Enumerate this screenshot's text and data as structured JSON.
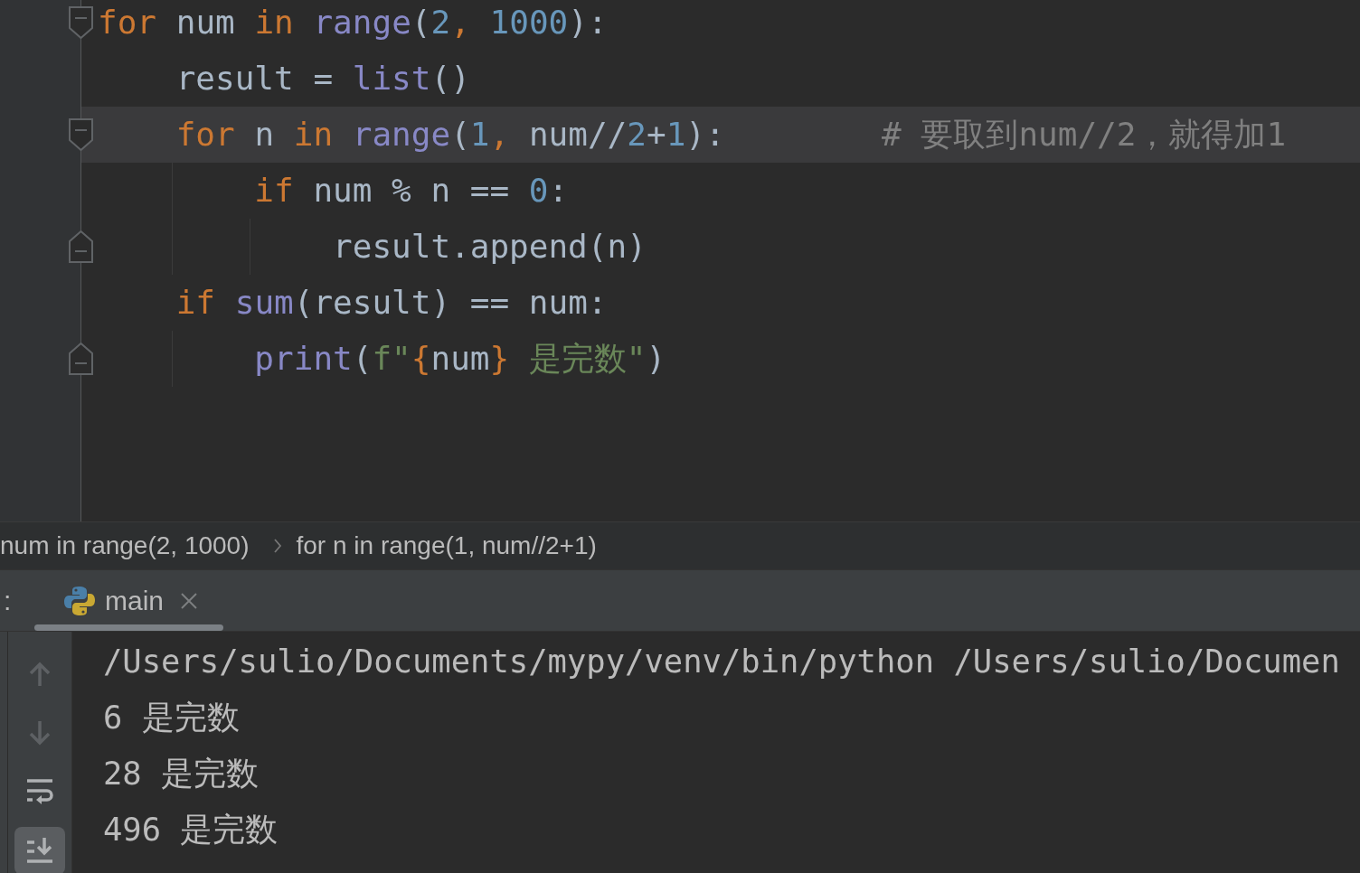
{
  "editor": {
    "lines": [
      {
        "expanded": true,
        "tokens": [
          {
            "kind": "keyword",
            "t": "for"
          },
          {
            "kind": "plain",
            "t": " num "
          },
          {
            "kind": "keyword",
            "t": "in"
          },
          {
            "kind": "builtin",
            "t": " range"
          },
          {
            "kind": "plain",
            "t": "("
          },
          {
            "kind": "number",
            "t": "2"
          },
          {
            "kind": "keyword",
            "t": ", "
          },
          {
            "kind": "number",
            "t": "1000"
          },
          {
            "kind": "plain",
            "t": "):"
          }
        ],
        "children": [
          {
            "tokens": [
              {
                "kind": "plain",
                "t": "result = "
              },
              {
                "kind": "builtin",
                "t": "list"
              },
              {
                "kind": "plain",
                "t": "()"
              }
            ]
          },
          {
            "expanded": true,
            "current": true,
            "tokens": [
              {
                "kind": "keyword",
                "t": "for"
              },
              {
                "kind": "plain",
                "t": " n "
              },
              {
                "kind": "keyword",
                "t": "in"
              },
              {
                "kind": "builtin",
                "t": " range"
              },
              {
                "kind": "plain",
                "t": "("
              },
              {
                "kind": "number",
                "t": "1"
              },
              {
                "kind": "keyword",
                "t": ", "
              },
              {
                "kind": "plain",
                "t": "num//"
              },
              {
                "kind": "number",
                "t": "2"
              },
              {
                "kind": "plain",
                "t": "+"
              },
              {
                "kind": "number",
                "t": "1"
              },
              {
                "kind": "plain",
                "t": "):"
              },
              {
                "kind": "comment",
                "t": "        # 要取到num//2，就得加1"
              }
            ],
            "children": [
              {
                "tokens": [
                  {
                    "kind": "keyword",
                    "t": "if"
                  },
                  {
                    "kind": "plain",
                    "t": " num % n == "
                  },
                  {
                    "kind": "number",
                    "t": "0"
                  },
                  {
                    "kind": "plain",
                    "t": ":"
                  }
                ],
                "children": [
                  {
                    "tokens": [
                      {
                        "kind": "plain",
                        "t": "result.append(n)"
                      }
                    ]
                  }
                ]
              }
            ]
          },
          {
            "tokens": [
              {
                "kind": "keyword",
                "t": "if"
              },
              {
                "kind": "builtin",
                "t": " sum"
              },
              {
                "kind": "plain",
                "t": "(result) == num:"
              }
            ],
            "children": [
              {
                "tokens": [
                  {
                    "kind": "builtin",
                    "t": "print"
                  },
                  {
                    "kind": "plain",
                    "t": "("
                  },
                  {
                    "kind": "string",
                    "t": "f\""
                  },
                  {
                    "kind": "keyword",
                    "t": "{"
                  },
                  {
                    "kind": "plain",
                    "t": "num"
                  },
                  {
                    "kind": "keyword",
                    "t": "}"
                  },
                  {
                    "kind": "string",
                    "t": " 是完数\""
                  },
                  {
                    "kind": "plain",
                    "t": ")"
                  }
                ]
              }
            ]
          }
        ]
      }
    ]
  },
  "breadcrumbs": [
    "num in range(2, 1000)",
    "for n in range(1, num//2+1)"
  ],
  "run_panel": {
    "label": ":",
    "tabs": [
      {
        "title": "main",
        "selected": true
      }
    ],
    "toolbar": [
      {
        "kind": "up",
        "disabled": true,
        "selected": false
      },
      {
        "kind": "down",
        "disabled": true,
        "selected": false
      },
      {
        "kind": "wrap",
        "disabled": false,
        "selected": false
      },
      {
        "kind": "scroll-end",
        "disabled": false,
        "selected": true
      }
    ],
    "output": [
      "/Users/sulio/Documents/mypy/venv/bin/python /Users/sulio/Documen",
      "6 是完数",
      "28 是完数",
      "496 是完数"
    ]
  }
}
